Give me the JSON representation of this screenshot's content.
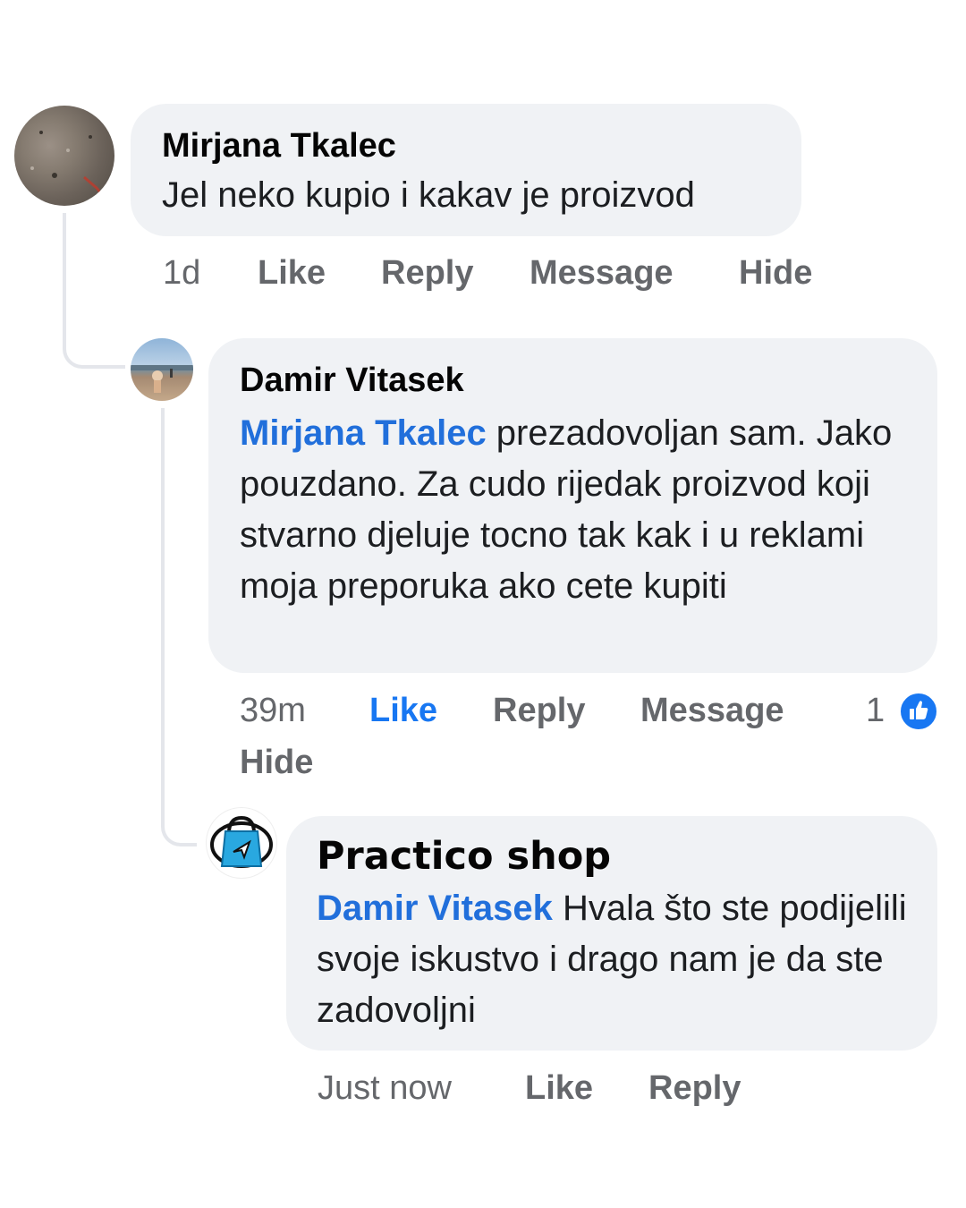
{
  "comments": [
    {
      "author": "Mirjana Tkalec",
      "text": "Jel neko kupio i kakav je proizvod",
      "actions": {
        "time": "1d",
        "like": "Like",
        "reply": "Reply",
        "message": "Message",
        "hide": "Hide"
      }
    },
    {
      "author": "Damir Vitasek",
      "mention": "Mirjana Tkalec",
      "text_line1": " prezadovoljan sam.",
      "text_rest": "Jako pouzdano. Za cudo rijedak proizvod koji stvarno djeluje tocno tak kak i u reklami moja preporuka ako cete kupiti",
      "actions": {
        "time": "39m",
        "like": "Like",
        "reply": "Reply",
        "message": "Message",
        "hide": "Hide"
      },
      "reaction_count": "1",
      "reaction_icon": "thumbs-up-icon",
      "liked_color": "#1877f2"
    },
    {
      "author": "Practico shop",
      "mention": "Damir Vitasek",
      "text_line1": " Hvala što ste",
      "text_rest": "podijelili svoje iskustvo i drago nam je da ste zadovoljni",
      "actions": {
        "time": "Just now",
        "like": "Like",
        "reply": "Reply"
      },
      "avatar_icon": "shopping-bag-icon"
    }
  ],
  "colors": {
    "bubble": "#f0f2f5",
    "mention": "#216fdb",
    "meta": "#65676b",
    "brand": "#1877f2"
  }
}
